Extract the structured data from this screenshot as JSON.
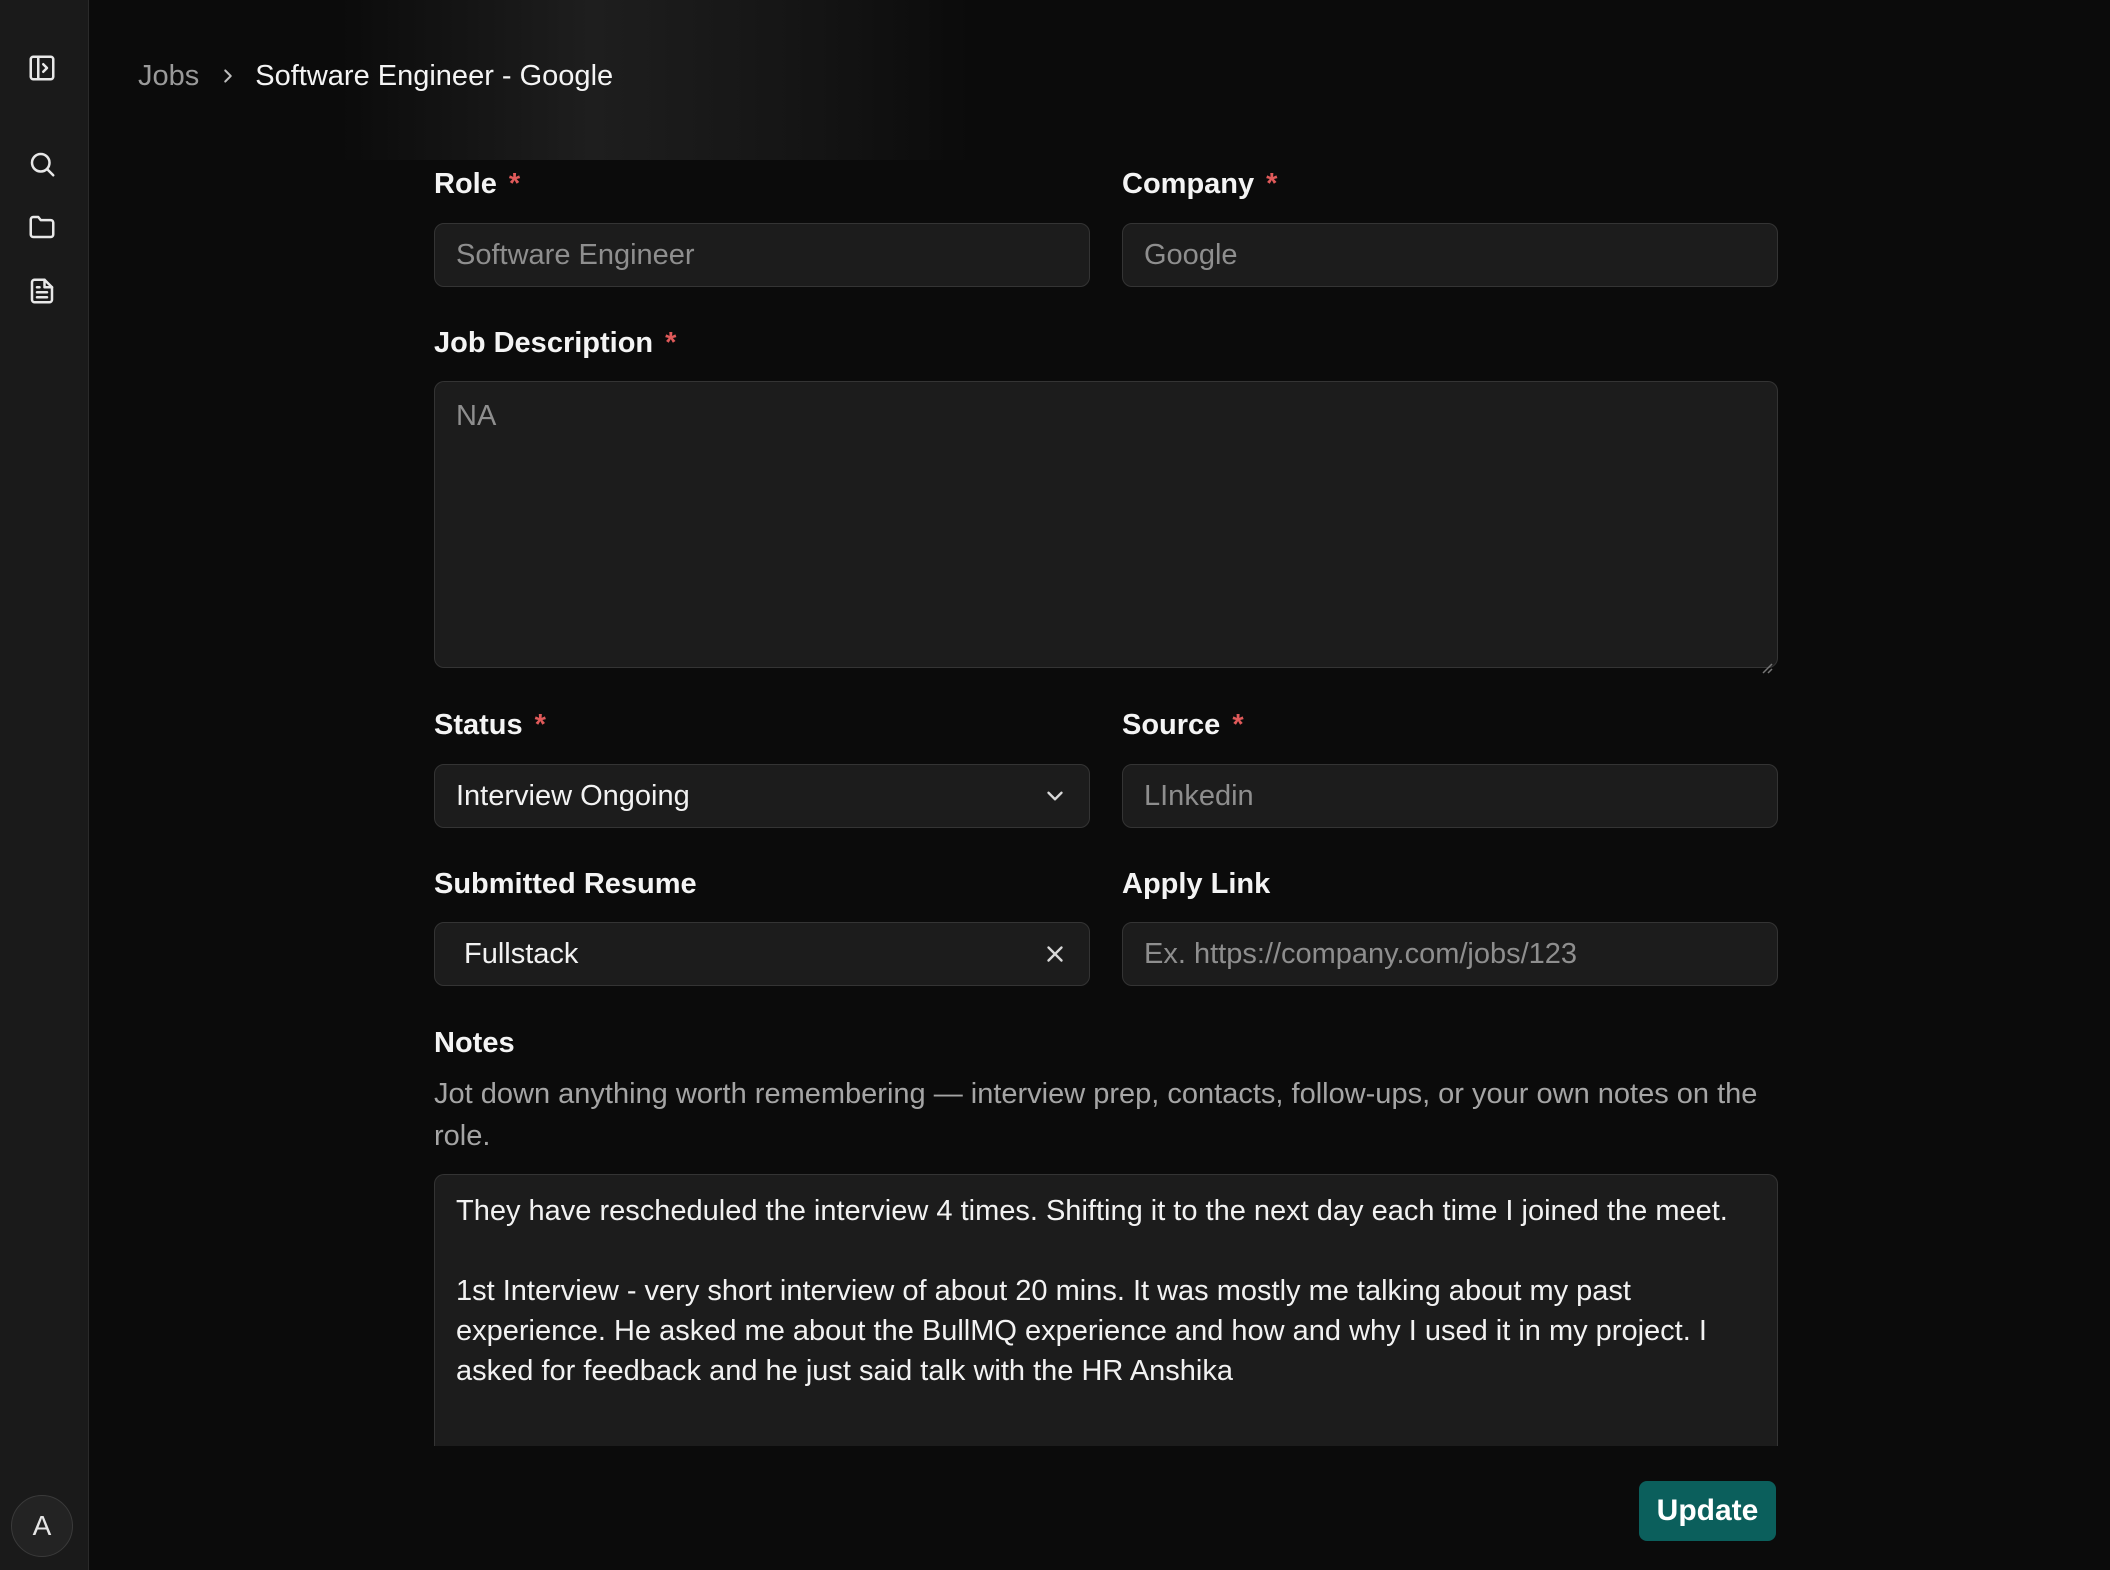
{
  "sidebar": {
    "items": [
      {
        "name": "toggle-sidebar",
        "icon": "panel-toggle-icon"
      },
      {
        "name": "search",
        "icon": "search-icon"
      },
      {
        "name": "folder",
        "icon": "folder-icon"
      },
      {
        "name": "document",
        "icon": "file-text-icon"
      }
    ],
    "avatar_initial": "A"
  },
  "breadcrumb": {
    "parent": "Jobs",
    "current": "Software Engineer - Google"
  },
  "form": {
    "required_mark": "*",
    "role": {
      "label": "Role",
      "placeholder": "Software Engineer"
    },
    "company": {
      "label": "Company",
      "placeholder": "Google"
    },
    "job_description": {
      "label": "Job Description",
      "placeholder": "NA"
    },
    "status": {
      "label": "Status",
      "value": "Interview Ongoing"
    },
    "source": {
      "label": "Source",
      "placeholder": "LInkedin"
    },
    "submitted_resume": {
      "label": "Submitted Resume",
      "value": "Fullstack"
    },
    "apply_link": {
      "label": "Apply Link",
      "placeholder": "Ex. https://company.com/jobs/123"
    },
    "notes": {
      "label": "Notes",
      "helper": "Jot down anything worth remembering — interview prep, contacts, follow-ups, or your own notes on the role.",
      "paragraph_1": "They have rescheduled the interview 4 times. Shifting it to the next day each time I joined the meet.",
      "paragraph_2": "1st Interview - very short interview of about 20 mins. It was mostly me talking about my past experience. He asked me about the BullMQ experience and how and why I used it in my project. I asked for feedback and he just said talk with the HR Anshika"
    }
  },
  "actions": {
    "update_label": "Update"
  },
  "colors": {
    "background": "#0b0b0b",
    "sidebar": "#1a1a1a",
    "input_bg": "#1c1c1c",
    "required": "#e05a5a",
    "primary_button": "#0b5f5c"
  }
}
